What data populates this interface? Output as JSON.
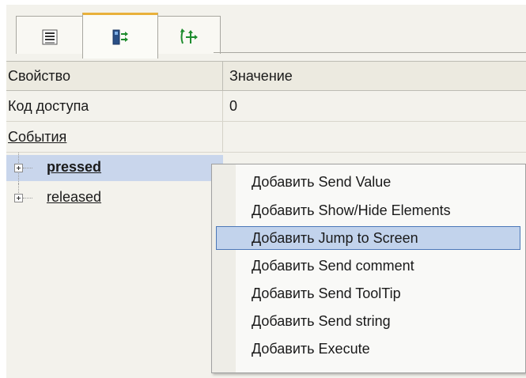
{
  "tabs": [
    {
      "name": "list-tab",
      "icon": "list-icon"
    },
    {
      "name": "events-tab",
      "icon": "events-icon",
      "active": true
    },
    {
      "name": "move-tab",
      "icon": "move-arrows-icon"
    }
  ],
  "grid": {
    "header": {
      "name_col": "Свойство",
      "value_col": "Значение"
    },
    "rows": {
      "access_code": {
        "label": "Код доступа",
        "value": "0"
      },
      "events": {
        "label": "События"
      }
    },
    "event_items": [
      {
        "label": "pressed",
        "selected": true
      },
      {
        "label": "released",
        "selected": false
      }
    ]
  },
  "context_menu": {
    "items": [
      "Добавить Send Value",
      "Добавить Show/Hide Elements",
      "Добавить Jump to Screen",
      "Добавить Send comment",
      "Добавить Send ToolTip",
      "Добавить Send string",
      "Добавить Execute"
    ],
    "highlighted_index": 2
  },
  "colors": {
    "active_tab_accent": "#e9b13b",
    "selection": "#c9d6ec",
    "menu_highlight": "#c2d3ec",
    "menu_highlight_border": "#4c78b8"
  }
}
